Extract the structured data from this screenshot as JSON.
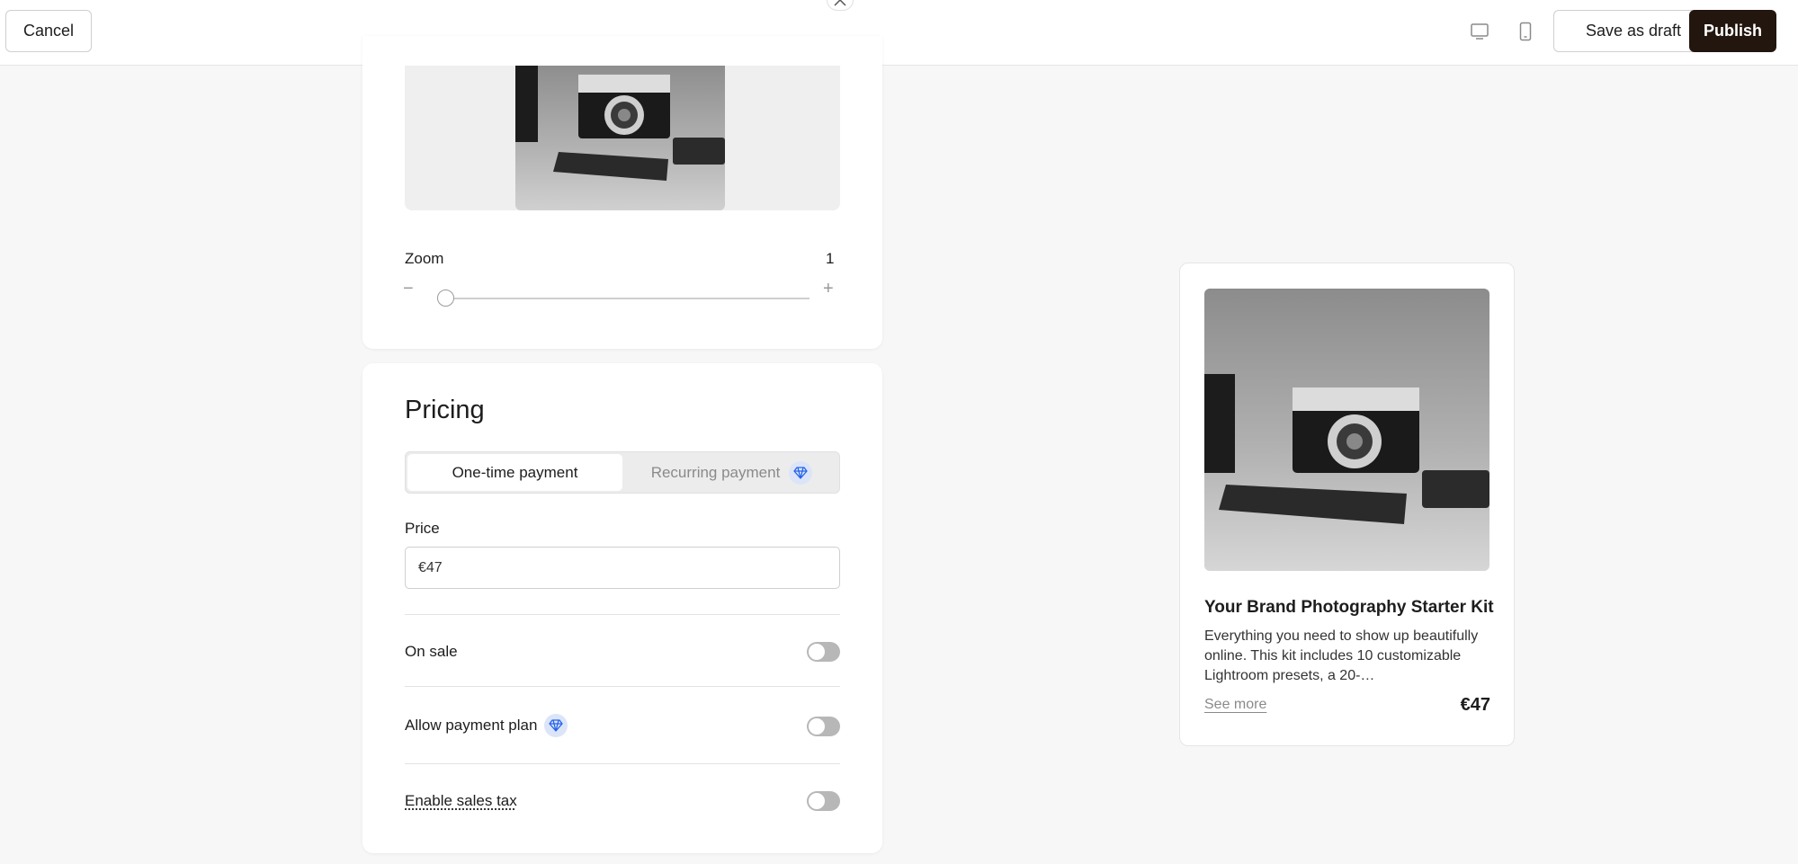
{
  "header": {
    "cancel_label": "Cancel",
    "save_draft_label": "Save as draft",
    "publish_label": "Publish",
    "view_icons": [
      "desktop-icon",
      "mobile-icon"
    ],
    "accent_color": "#23160f"
  },
  "image_editor": {
    "zoom_label": "Zoom",
    "zoom_value": "1",
    "zoom_minus": "−",
    "zoom_plus": "+",
    "zoom_level": 0
  },
  "pricing": {
    "title": "Pricing",
    "payment_types": [
      "One-time payment",
      "Recurring payment"
    ],
    "selected_payment_type": "One-time payment",
    "price_label": "Price",
    "price_value": "€47",
    "options": [
      {
        "label": "On sale",
        "enabled": false
      },
      {
        "label": "Allow payment plan",
        "enabled": false,
        "premium": true
      },
      {
        "label": "Enable sales tax",
        "enabled": false
      }
    ]
  },
  "preview": {
    "title": "Your Brand Photography Starter Kit",
    "description": "Everything you need to show up beautifully online. This kit includes 10 customizable Lightroom presets, a 20-…",
    "see_more": "See more",
    "price": "€47"
  }
}
